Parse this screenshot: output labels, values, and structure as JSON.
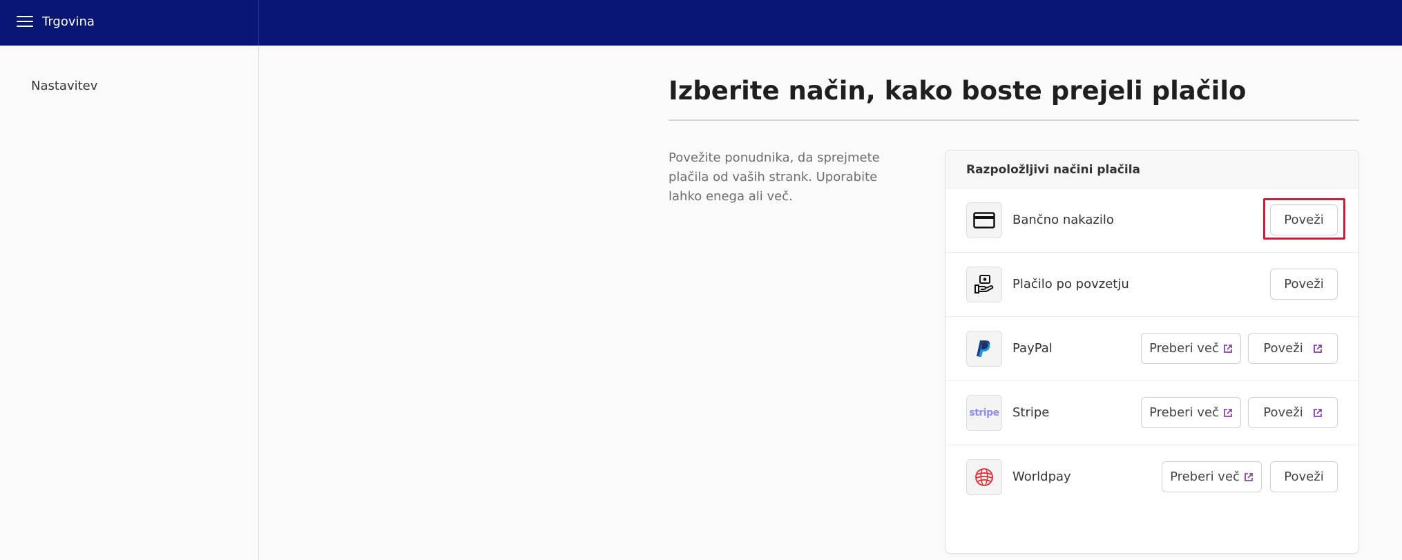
{
  "topbar": {
    "app_title": "Trgovina",
    "bg_color": "#0a1673"
  },
  "sidebar": {
    "items": [
      {
        "label": "Nastavitev"
      }
    ]
  },
  "main": {
    "title": "Izberite način, kako boste prejeli plačilo",
    "description": "Povežite ponudnika, da sprejmete plačila od vaših strank. Uporabite lahko enega ali več.",
    "card": {
      "header": "Razpoložljivi načini plačila",
      "providers": [
        {
          "name": "Bančno nakazilo",
          "icon": "credit-card-icon",
          "connect_label": "Poveži",
          "connect_external": false
        },
        {
          "name": "Plačilo po povzetju",
          "icon": "cash-on-delivery-icon",
          "connect_label": "Poveži",
          "connect_external": false
        },
        {
          "name": "PayPal",
          "icon": "paypal-logo-icon",
          "learn_more_label": "Preberi več",
          "connect_label": "Poveži",
          "connect_external": true
        },
        {
          "name": "Stripe",
          "icon": "stripe-logo-icon",
          "icon_text": "stripe",
          "learn_more_label": "Preberi več",
          "connect_label": "Poveži",
          "connect_external": true
        },
        {
          "name": "Worldpay",
          "icon": "worldpay-logo-icon",
          "learn_more_label": "Preberi več",
          "connect_label": "Poveži",
          "connect_external": false
        }
      ]
    }
  },
  "colors": {
    "accent_external": "#8a3fb8",
    "highlight": "#c4203a"
  }
}
